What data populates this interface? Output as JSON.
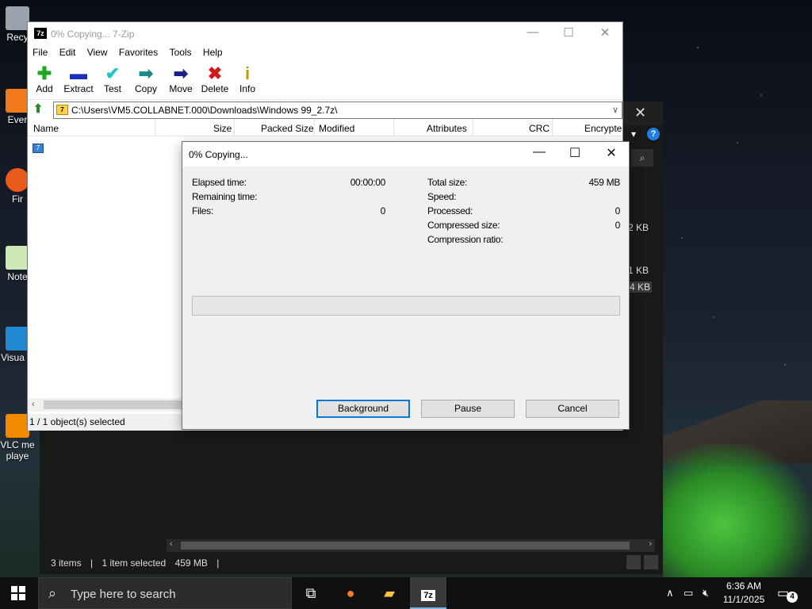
{
  "desktop": {
    "icons": [
      "Recy",
      "Ever",
      "Fir",
      "Note",
      "Visua C",
      "VLC me playe"
    ]
  },
  "explorer": {
    "status": {
      "items": "3 items",
      "selected": "1 item selected",
      "size": "459 MB"
    },
    "file_sizes": [
      "2 KB",
      "1 KB",
      "4 KB"
    ]
  },
  "zip": {
    "title": "0% Copying... 7-Zip",
    "menu": [
      "File",
      "Edit",
      "View",
      "Favorites",
      "Tools",
      "Help"
    ],
    "toolbar": {
      "add": "Add",
      "extract": "Extract",
      "test": "Test",
      "copy": "Copy",
      "move": "Move",
      "delete": "Delete",
      "info": "Info"
    },
    "address": "C:\\Users\\VM5.COLLABNET.000\\Downloads\\Windows 99_2.7z\\",
    "columns": [
      "Name",
      "Size",
      "Packed Size",
      "Modified",
      "Attributes",
      "CRC",
      "Encrypte"
    ],
    "status": "1 / 1 object(s) selected"
  },
  "dialog": {
    "title": "0% Copying...",
    "left": {
      "elapsed_label": "Elapsed time:",
      "elapsed_value": "00:00:00",
      "remaining_label": "Remaining time:",
      "files_label": "Files:",
      "files_value": "0"
    },
    "right": {
      "total_label": "Total size:",
      "total_value": "459 MB",
      "speed_label": "Speed:",
      "processed_label": "Processed:",
      "processed_value": "0",
      "compressed_label": "Compressed size:",
      "compressed_value": "0",
      "ratio_label": "Compression ratio:"
    },
    "progress_percent": 0,
    "buttons": {
      "background": "Background",
      "pause": "Pause",
      "cancel": "Cancel"
    }
  },
  "taskbar": {
    "search_placeholder": "Type here to search",
    "time": "6:36 AM",
    "date": "11/1/2025",
    "notifications": "4"
  }
}
